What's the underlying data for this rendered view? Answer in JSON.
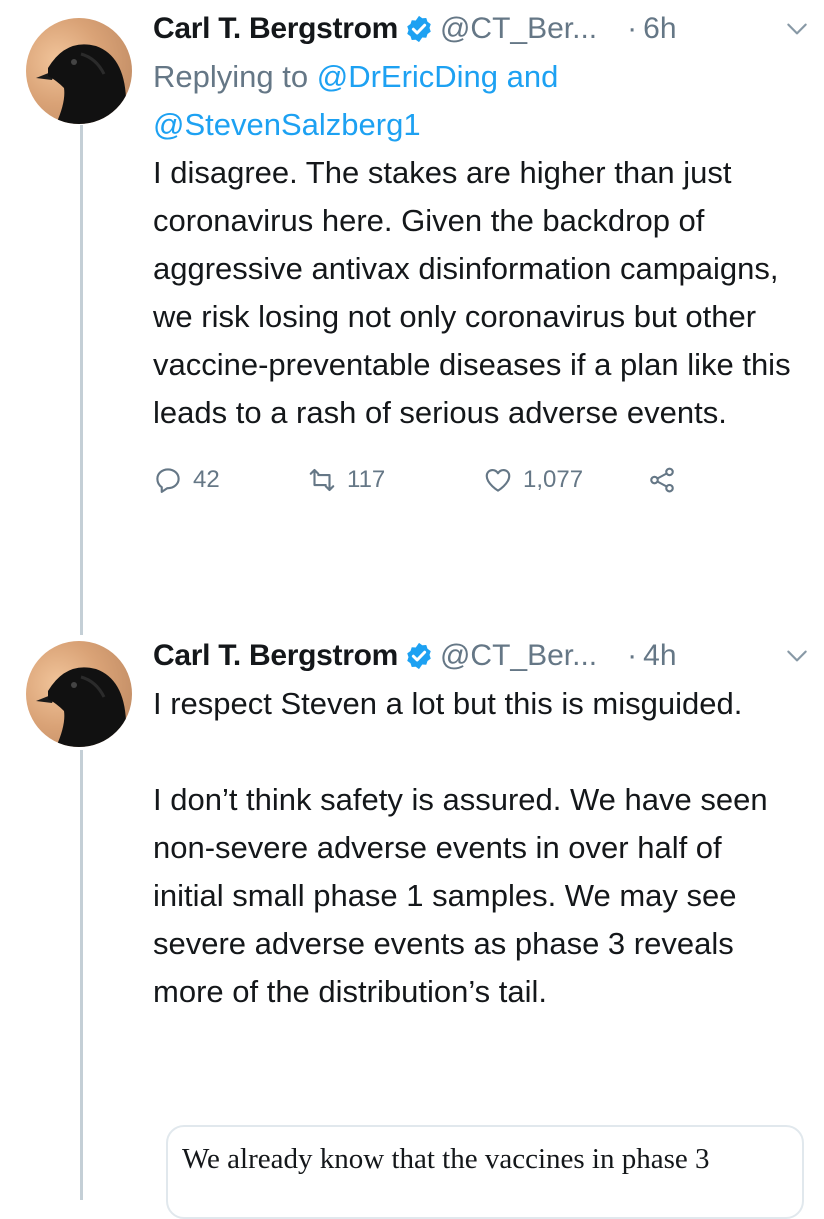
{
  "tweets": [
    {
      "name": "Carl T. Bergstrom",
      "handle": "@CT_Ber...",
      "dot": "·",
      "time": "6h",
      "replying_prefix": "Replying to ",
      "replying_to_1": "@DrEricDing",
      "replying_and": " and",
      "replying_to_2": "@StevenSalzberg1",
      "text": "I disagree. The stakes are higher than just coronavirus here. Given the backdrop of aggressive antivax disinformation campaigns, we risk losing not only coronavirus but other vaccine-preventable diseases if a plan like this leads to a rash of serious adverse events.",
      "replies": "42",
      "retweets": "117",
      "likes": "1,077"
    },
    {
      "name": "Carl T. Bergstrom",
      "handle": "@CT_Ber...",
      "dot": "·",
      "time": "4h",
      "text": "I respect Steven a lot but this is misguided.\n\nI don’t think safety is assured. We have seen non-severe adverse events in over half of initial small phase 1 samples. We may see severe adverse events as phase 3 reveals more of the distribution’s tail.",
      "quote_text": "We already know that the vaccines in phase 3"
    }
  ],
  "icons": {
    "verified": "verified-badge-icon",
    "chevron": "chevron-down-icon",
    "reply": "reply-icon",
    "retweet": "retweet-icon",
    "like": "heart-icon",
    "share": "share-icon"
  },
  "colors": {
    "accent": "#1da1f2",
    "secondary_text": "#657786",
    "thread_line": "#c4cfd6"
  }
}
